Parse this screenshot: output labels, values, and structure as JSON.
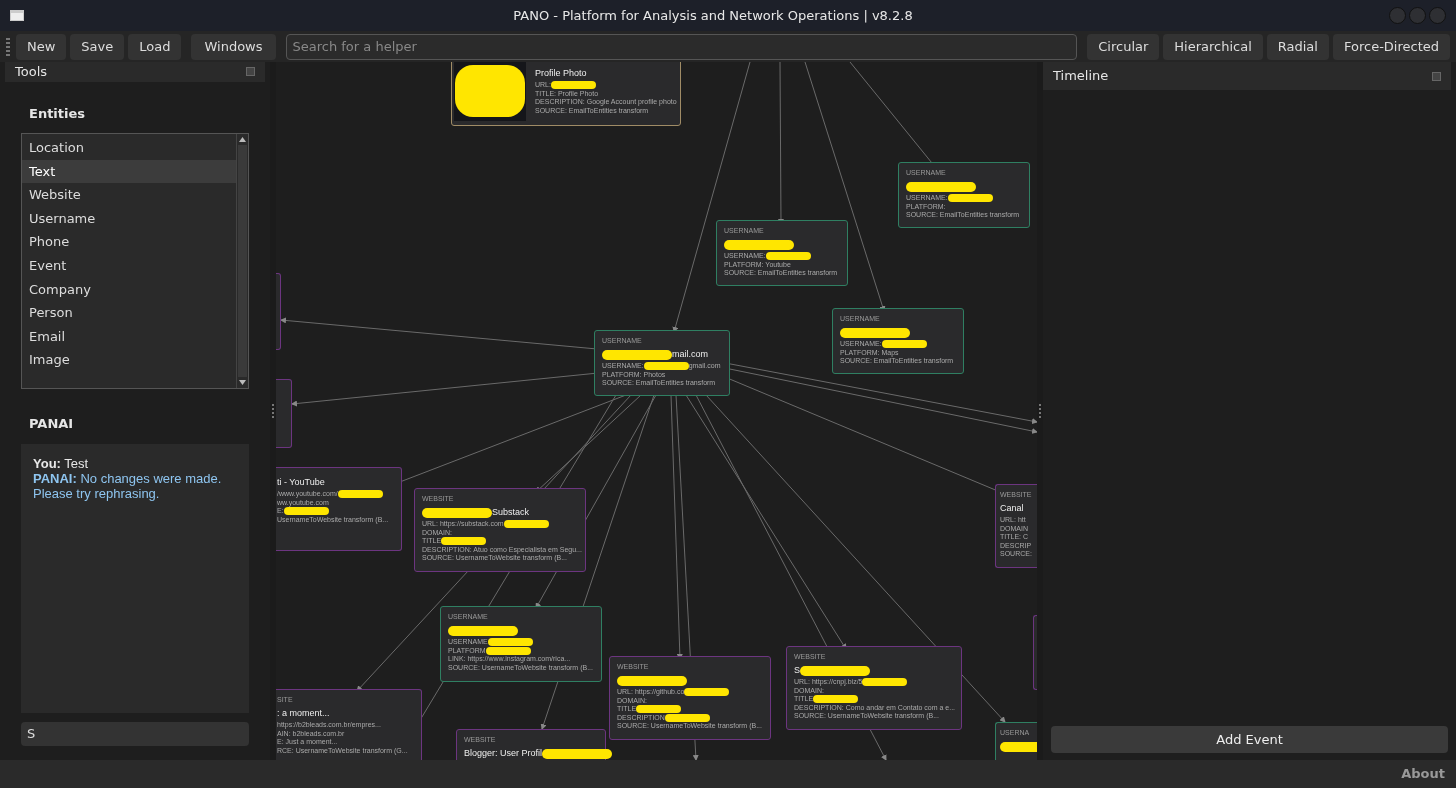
{
  "window": {
    "title": "PANO - Platform for Analysis and Network Operations | v8.2.8"
  },
  "toolbar": {
    "file_buttons": [
      "New",
      "Save",
      "Load"
    ],
    "windows_button": "Windows",
    "search": {
      "placeholder": "Search for a helper"
    },
    "layout_buttons": [
      "Circular",
      "Hierarchical",
      "Radial",
      "Force-Directed"
    ]
  },
  "tools_panel": {
    "title": "Tools",
    "entities": {
      "heading": "Entities",
      "items": [
        {
          "label": "Location",
          "selected": false
        },
        {
          "label": "Text",
          "selected": true
        },
        {
          "label": "Website",
          "selected": false
        },
        {
          "label": "Username",
          "selected": false
        },
        {
          "label": "Phone",
          "selected": false
        },
        {
          "label": "Event",
          "selected": false
        },
        {
          "label": "Company",
          "selected": false
        },
        {
          "label": "Person",
          "selected": false
        },
        {
          "label": "Email",
          "selected": false
        },
        {
          "label": "Image",
          "selected": false
        }
      ]
    },
    "panai": {
      "heading": "PANAI",
      "messages": [
        {
          "kind": "user",
          "speaker": "You:",
          "text": "Test"
        },
        {
          "kind": "assistant",
          "speaker": "PANAI:",
          "text": "No changes were made. Please try rephrasing."
        }
      ],
      "input": {
        "value": "S"
      }
    }
  },
  "graph": {
    "nodes": [
      {
        "kind": "image",
        "title": [
          "Profile Photo"
        ],
        "lines": [
          [
            "URL:",
            {
              "kind": "redaction"
            }
          ],
          [
            "TITLE: Profile Photo"
          ],
          [
            "DESCRIPTION: Google Account profile photo"
          ],
          [
            "SOURCE: EmailToEntities transform"
          ]
        ]
      },
      {
        "kind": "username",
        "type_label": "USERNAME",
        "title": [
          {
            "kind": "redaction"
          }
        ],
        "lines": [
          [
            "USERNAME:",
            {
              "kind": "redaction"
            }
          ],
          [
            "PLATFORM:"
          ],
          [
            "SOURCE: EmailToEntities transform"
          ]
        ]
      },
      {
        "kind": "username",
        "type_label": "USERNAME",
        "title": [
          {
            "kind": "redaction"
          }
        ],
        "lines": [
          [
            "USERNAME:",
            {
              "kind": "redaction"
            }
          ],
          [
            "PLATFORM: Youtube"
          ],
          [
            "SOURCE: EmailToEntities transform"
          ]
        ]
      },
      {
        "kind": "username",
        "type_label": "USERNAME",
        "title": [
          {
            "kind": "redaction"
          }
        ],
        "lines": [
          [
            "USERNAME:",
            {
              "kind": "redaction"
            }
          ],
          [
            "PLATFORM: Maps"
          ],
          [
            "SOURCE: EmailToEntities transform"
          ]
        ]
      },
      {
        "kind": "username",
        "type_label": "USERNAME",
        "title": [
          {
            "kind": "redaction"
          },
          "mail.com"
        ],
        "lines": [
          [
            "USERNAME:",
            {
              "kind": "redaction"
            },
            "gmail.com"
          ],
          [
            "PLATFORM: Photos"
          ],
          [
            "SOURCE: EmailToEntities transform"
          ]
        ]
      },
      {
        "kind": "website"
      },
      {
        "kind": "website"
      },
      {
        "kind": "website",
        "title": [
          "ti - YouTube"
        ],
        "lines": [
          [
            "/www.youtube.com/",
            {
              "kind": "redaction"
            }
          ],
          [
            "ww.youtube.com"
          ],
          [
            "E:",
            {
              "kind": "redaction"
            }
          ],
          [
            "UsernameToWebsite transform (B..."
          ]
        ]
      },
      {
        "kind": "website",
        "type_label": "WEBSITE",
        "title": [
          {
            "kind": "redaction"
          },
          "Substack"
        ],
        "lines": [
          [
            "URL: https://substack.com",
            {
              "kind": "redaction"
            }
          ],
          [
            "DOMAIN:"
          ],
          [
            "TITLE",
            {
              "kind": "redaction"
            }
          ],
          [
            "DESCRIPTION: Atuo como Especialista em Segu..."
          ],
          [
            "SOURCE: UsernameToWebsite transform (B..."
          ]
        ]
      },
      {
        "kind": "username",
        "type_label": "USERNAME",
        "title": [
          {
            "kind": "redaction"
          }
        ],
        "lines": [
          [
            "USERNAME",
            {
              "kind": "redaction"
            }
          ],
          [
            "PLATFORM",
            {
              "kind": "redaction"
            }
          ],
          [
            "LINK: https://www.instagram.com/rica..."
          ],
          [
            "SOURCE: UsernameToWebsite transform (B..."
          ]
        ]
      },
      {
        "kind": "website",
        "type_label": "SITE",
        "title": [
          ": a moment..."
        ],
        "lines": [
          [
            "https://b2bleads.com.br/empres..."
          ],
          [
            "AIN: b2bleads.com.br"
          ],
          [
            "E: Just a moment..."
          ],
          [
            "RCE: UsernameToWebsite transform (G..."
          ]
        ]
      },
      {
        "kind": "website",
        "type_label": "WEBSITE",
        "title": [
          "Blogger: User Profil",
          {
            "kind": "redaction"
          }
        ]
      },
      {
        "kind": "website",
        "type_label": "WEBSITE",
        "title": [
          {
            "kind": "redaction"
          }
        ],
        "lines": [
          [
            "URL: https://github.co",
            {
              "kind": "redaction"
            }
          ],
          [
            "DOMAIN:"
          ],
          [
            "TITLE",
            {
              "kind": "redaction"
            }
          ],
          [
            "DESCRIPTION",
            {
              "kind": "redaction"
            }
          ],
          [
            "SOURCE: UsernameToWebsite transform (B..."
          ]
        ]
      },
      {
        "kind": "website",
        "type_label": "WEBSITE",
        "title": [
          "S",
          {
            "kind": "redaction"
          }
        ],
        "lines": [
          [
            "URL: https://cnpj.biz/5",
            {
              "kind": "redaction"
            }
          ],
          [
            "DOMAIN:"
          ],
          [
            "TITLE",
            {
              "kind": "redaction"
            }
          ],
          [
            "DESCRIPTION: Como andar em Contato com a e..."
          ],
          [
            "SOURCE: UsernameToWebsite transform (B..."
          ]
        ]
      },
      {
        "kind": "website",
        "type_label": "WEBSITE",
        "title": [
          "Canal"
        ],
        "lines": [
          [
            "URL: htt"
          ],
          [
            "DOMAIN"
          ],
          [
            "TITLE: C"
          ],
          [
            "DESCRIP"
          ],
          [
            "SOURCE:"
          ]
        ]
      },
      {
        "kind": "website"
      },
      {
        "kind": "username",
        "type_label": "USERNA",
        "title": [
          {
            "kind": "redaction"
          }
        ]
      }
    ]
  },
  "timeline_panel": {
    "title": "Timeline",
    "add_button": "Add Event"
  },
  "status_bar": {
    "about": "About"
  }
}
